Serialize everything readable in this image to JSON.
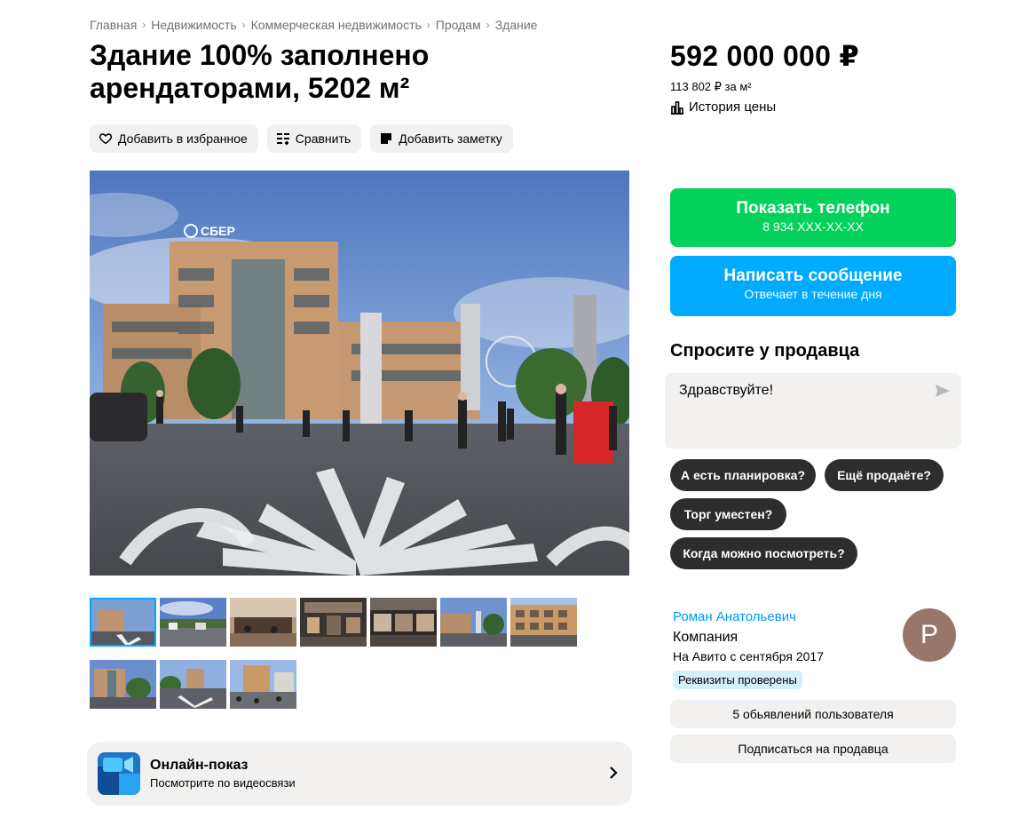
{
  "breadcrumb": [
    "Главная",
    "Недвижимость",
    "Коммерческая недвижимость",
    "Продам",
    "Здание"
  ],
  "title": "Здание 100% заполнено арендаторами, 5202 м²",
  "actions": {
    "favorite": "Добавить в избранное",
    "compare": "Сравнить",
    "note": "Добавить заметку"
  },
  "photo": {
    "sign": "СБЕР",
    "thumbnails_count": 10,
    "active_thumbnail": 1
  },
  "online_show": {
    "title": "Онлайн-показ",
    "subtitle": "Посмотрите по видеосвязи"
  },
  "price": {
    "total": "592 000 000 ₽",
    "per_meter": "113 802 ₽ за м²",
    "history": "История цены"
  },
  "contact": {
    "phone_label": "Показать телефон",
    "phone_number": "8 934 XXX-XX-XX",
    "message_label": "Написать сообщение",
    "message_sub": "Отвечает в течение дня"
  },
  "ask": {
    "title": "Спросите у продавца",
    "message": "Здравствуйте!",
    "chips": [
      "А есть планировка?",
      "Ещё продаёте?",
      "Торг уместен?",
      "Когда можно посмотреть?"
    ]
  },
  "seller": {
    "name": "Роман Анатольевич",
    "type": "Компания",
    "since": "На Авито с сентября 2017",
    "verified": "Реквизиты проверены",
    "avatar_letter": "Р",
    "listings": "5 обьявлений пользователя",
    "subscribe": "Подписаться на продавца"
  },
  "colors": {
    "green": "#02d15c",
    "blue": "#00aaff",
    "link": "#0099f7",
    "chip": "#2d2d2d",
    "avatar": "#98766a"
  }
}
